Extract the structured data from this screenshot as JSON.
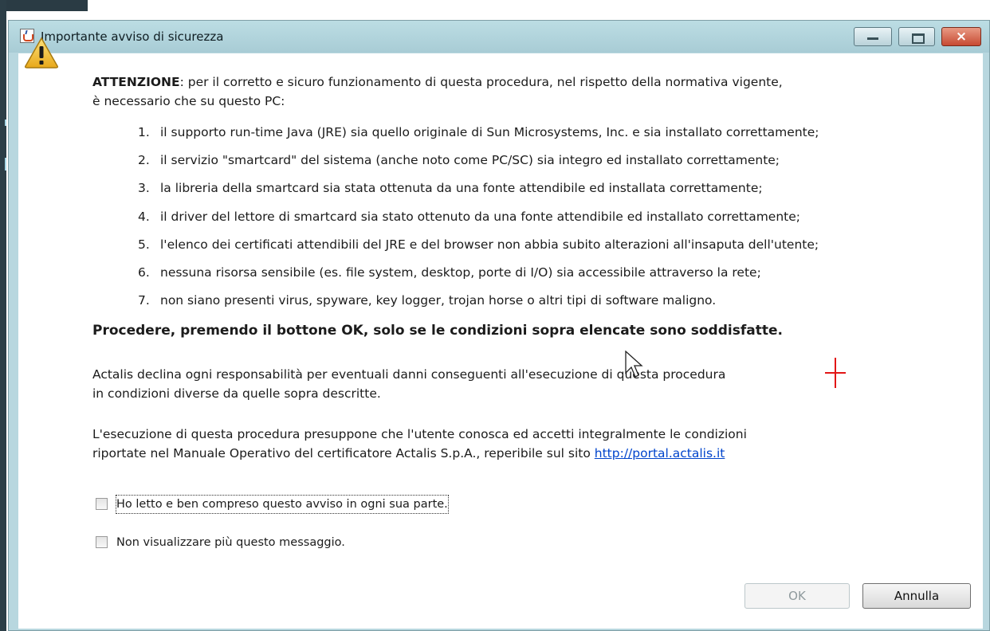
{
  "window": {
    "title": "Importante avviso di sicurezza",
    "buttons": {
      "minimize": "minimize",
      "maximize": "maximize",
      "close": "×"
    }
  },
  "icons": {
    "app": "java-icon",
    "warning": "warning-triangle-icon",
    "cursor": "mouse-pointer-icon"
  },
  "message": {
    "attention_label": "ATTENZIONE",
    "attention_text": ": per il corretto e sicuro funzionamento di questa procedura, nel rispetto della normativa vigente,",
    "attention_line2": "è necessario che su questo PC:",
    "conditions": [
      {
        "num": "1.",
        "text": "il supporto run-time Java (JRE) sia quello originale di Sun Microsystems, Inc. e sia installato correttamente;"
      },
      {
        "num": "2.",
        "text": "il servizio \"smartcard\" del sistema (anche noto come PC/SC) sia integro ed installato correttamente;"
      },
      {
        "num": "3.",
        "text": "la libreria della smartcard sia stata ottenuta da una fonte attendibile ed installata correttamente;"
      },
      {
        "num": "4.",
        "text": "il driver del lettore di smartcard sia stato ottenuto da una fonte attendibile ed installato correttamente;"
      },
      {
        "num": "5.",
        "text": "l'elenco dei certificati attendibili del JRE e del browser non abbia subito alterazioni all'insaputa dell'utente;"
      },
      {
        "num": "6.",
        "text": "nessuna risorsa sensibile (es. file system, desktop, porte di I/O) sia accessibile attraverso la rete;"
      },
      {
        "num": "7.",
        "text": "non siano presenti virus, spyware, key logger, trojan horse o altri tipi di software maligno."
      }
    ],
    "proceed": "Procedere, premendo il bottone OK, solo se le condizioni sopra elencate sono soddisfatte.",
    "disclaimer_line1": "Actalis declina ogni responsabilità per eventuali danni conseguenti all'esecuzione di questa procedura",
    "disclaimer_line2": "in condizioni diverse da quelle sopra descritte.",
    "terms_line1": "L'esecuzione di questa procedura presuppone che l'utente conosca ed accetti integralmente le condizioni",
    "terms_line2": "riportate nel Manuale Operativo del certificatore Actalis S.p.A., reperibile sul sito",
    "link": "http://portal.actalis.it"
  },
  "checkboxes": [
    {
      "label": "Ho letto e ben compreso questo avviso in ogni sua parte.",
      "checked": false
    },
    {
      "label": "Non visualizzare più questo messaggio.",
      "checked": false
    }
  ],
  "actions": {
    "ok": "OK",
    "ok_enabled": false,
    "cancel": "Annulla"
  },
  "colors": {
    "title_bar": "#b8d7df",
    "close_button": "#c74a32",
    "link": "#0044cc",
    "warning_fill": "#f2c22c"
  }
}
